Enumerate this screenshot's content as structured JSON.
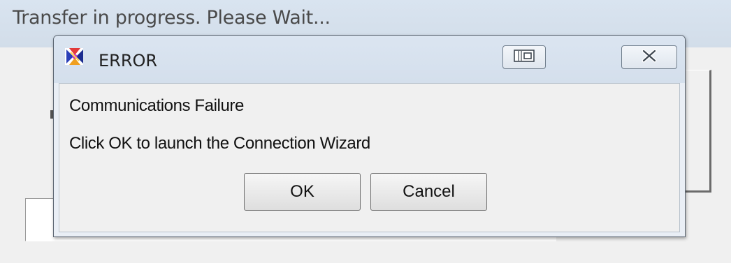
{
  "background_window": {
    "title": "Transfer in progress. Please Wait..."
  },
  "dialog": {
    "title": "ERROR",
    "icon": "app-logo-icon",
    "controls": {
      "restore_icon": "restore-icon",
      "close_icon": "close-icon"
    },
    "messages": {
      "line1": "Communications Failure",
      "line2": "Click OK to launch the Connection Wizard"
    },
    "buttons": {
      "ok": "OK",
      "cancel": "Cancel"
    }
  },
  "colors": {
    "titlebar": "#d4dfec",
    "client": "#f0f0f0",
    "border": "#5a6470"
  }
}
